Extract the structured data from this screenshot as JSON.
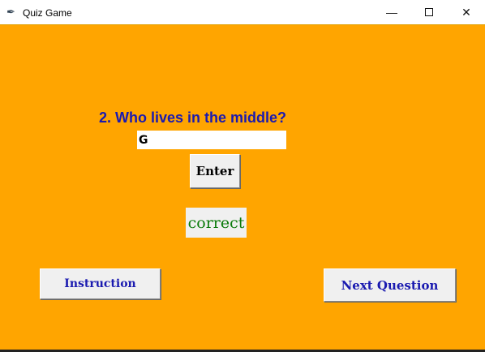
{
  "window": {
    "title": "Quiz Game",
    "app_icon": "feather-icon"
  },
  "quiz": {
    "question": "2. Who lives in the middle?",
    "answer_value": "G",
    "enter_label": "Enter",
    "result": "correct",
    "result_color": "#0a7a0a",
    "instruction_label": "Instruction",
    "next_label": "Next Question"
  },
  "colors": {
    "background": "#FFA500",
    "question": "#1a1ab0"
  }
}
